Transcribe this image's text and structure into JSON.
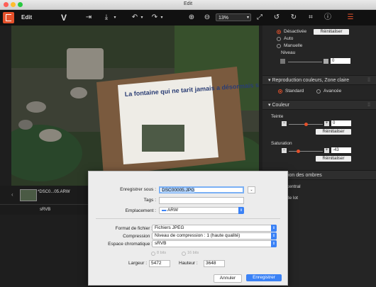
{
  "window": {
    "title": "Edit"
  },
  "toolbar": {
    "edit_label": "Edit",
    "zoom_value": "13%"
  },
  "right_panel": {
    "exposure": {
      "options": [
        "Désactivée",
        "Auto",
        "Manuelle"
      ],
      "reset_label": "Réinitialiser",
      "level_label": "Niveau",
      "level_value": "0"
    },
    "color_reproduction": {
      "title": "Reproduction couleurs, Zone claire",
      "options": [
        "Standard",
        "Avancée"
      ]
    },
    "color": {
      "title": "Couleur",
      "hue_label": "Teinte",
      "hue_value": "0",
      "hue_level": 0.5,
      "reset_label": "Réinitialiser",
      "saturation_label": "Saturation",
      "saturation_value": "-43",
      "saturation_level": 0.29
    },
    "shadows_title_partial": "tion des ombres",
    "partial_1": "central",
    "partial_2": "de lot"
  },
  "filmstrip": {
    "thumb_label": "*DSC0...05.ARW"
  },
  "statusbar": {
    "colorspace": "sRVB"
  },
  "photo": {
    "headline": "La fontaine qui ne tarit jamais a désormais sa stèle"
  },
  "dialog": {
    "save_as_label": "Enregistrer sous :",
    "filename": "DSC00005.JPG",
    "tags_label": "Tags :",
    "tags_value": "",
    "location_label": "Emplacement :",
    "location_value": "ARW",
    "format_label": "Format de fichier :",
    "format_value": "Fichiers JPEG",
    "compression_label": "Compression :",
    "compression_value": "Niveau de compression : 1 (haute qualité)",
    "colorspace_label": "Espace chromatique :",
    "colorspace_value": "sRVB",
    "bits8": "8 bits",
    "bits16": "16 bits",
    "width_label": "Largeur :",
    "width_value": "5472",
    "height_label": "Hauteur :",
    "height_value": "3648",
    "cancel_label": "Annuler",
    "save_label": "Enregistrer"
  },
  "colors": {
    "accent": "#e5512b",
    "primary_button": "#3b82f6"
  }
}
